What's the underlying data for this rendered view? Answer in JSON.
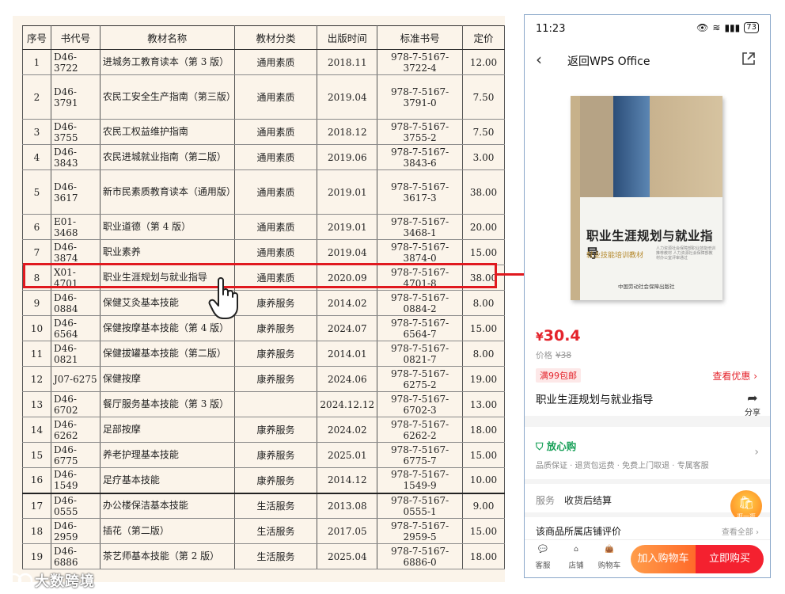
{
  "catalog": {
    "headers": [
      "序号",
      "书代号",
      "教材名称",
      "教材分类",
      "出版时间",
      "标准书号",
      "定价"
    ],
    "rows": [
      [
        "1",
        "D46-3722",
        "进城务工教育读本（第 3 版）",
        "通用素质",
        "2018.11",
        "978-7-5167-3722-4",
        "12.00"
      ],
      [
        "2",
        "D46-3791",
        "农民工安全生产指南（第三版）",
        "通用素质",
        "2019.04",
        "978-7-5167-3791-0",
        "7.50"
      ],
      [
        "3",
        "D46-3755",
        "农民工权益维护指南",
        "通用素质",
        "2018.12",
        "978-7-5167-3755-2",
        "7.50"
      ],
      [
        "4",
        "D46-3843",
        "农民进城就业指南（第二版）",
        "通用素质",
        "2019.06",
        "978-7-5167-3843-6",
        "3.00"
      ],
      [
        "5",
        "D46-3617",
        "新市民素质教育读本（通用版）",
        "通用素质",
        "2019.01",
        "978-7-5167-3617-3",
        "38.00"
      ],
      [
        "6",
        "E01-3468",
        "职业道德（第 4 版）",
        "通用素质",
        "2019.01",
        "978-7-5167-3468-1",
        "20.00"
      ],
      [
        "7",
        "D46-3874",
        "职业素养",
        "通用素质",
        "2019.04",
        "978-7-5167-3874-0",
        "15.00"
      ],
      [
        "8",
        "X01-4701",
        "职业生涯规划与就业指导",
        "通用素质",
        "2020.09",
        "978-7-5167-4701-8",
        "38.00"
      ],
      [
        "9",
        "D46-0884",
        "保健艾灸基本技能",
        "康养服务",
        "2014.02",
        "978-7-5167-0884-2",
        "8.00"
      ],
      [
        "10",
        "D46-6564",
        "保健按摩基本技能（第 4 版）",
        "康养服务",
        "2024.07",
        "978-7-5167-6564-7",
        "15.00"
      ],
      [
        "11",
        "D46-0821",
        "保健拔罐基本技能（第二版）",
        "康养服务",
        "2014.01",
        "978-7-5167-0821-7",
        "8.00"
      ],
      [
        "12",
        "J07-6275",
        "保健按摩",
        "康养服务",
        "2024.06",
        "978-7-5167-6275-2",
        "19.00"
      ],
      [
        "13",
        "D46-6702",
        "餐厅服务基本技能（第 3 版）",
        "",
        "2024.12.12",
        "978-7-5167-6702-3",
        "13.00"
      ],
      [
        "14",
        "D46-6262",
        "足部按摩",
        "康养服务",
        "2024.02",
        "978-7-5167-6262-2",
        "18.00"
      ],
      [
        "15",
        "D46-6775",
        "养老护理基本技能",
        "康养服务",
        "2025.01",
        "978-7-5167-6775-7",
        "15.00"
      ],
      [
        "16",
        "D46-1549",
        "足疗基本技能",
        "康养服务",
        "2014.12",
        "978-7-5167-1549-9",
        "10.00"
      ],
      [
        "17",
        "D46-0555",
        "办公楼保洁基本技能",
        "生活服务",
        "2013.08",
        "978-7-5167-0555-1",
        "9.00"
      ],
      [
        "18",
        "D46-2959",
        "插花（第二版）",
        "生活服务",
        "2017.05",
        "978-7-5167-2959-5",
        "15.00"
      ],
      [
        "19",
        "D46-6886",
        "茶艺师基本技能（第 2 版）",
        "生活服务",
        "2025.04",
        "978-7-5167-6886-0",
        "18.00"
      ]
    ],
    "highlight_row": 8
  },
  "watermark": "大数跨境",
  "phone": {
    "status": {
      "time": "11:23",
      "battery": "73"
    },
    "nav": {
      "title": "返回WPS Office"
    },
    "book_cover": {
      "title": "职业生涯规划与就业指导",
      "subtitle": "就业技能培训教材",
      "note": "人力资源社会保障部职业技能培训推荐教材 人力资源社会保障部教材办公室评审通过",
      "publisher": "中国劳动社会保障出版社"
    },
    "price": {
      "currency": "¥",
      "value": "30.4",
      "orig_label": "价格",
      "orig_value": "¥38"
    },
    "promo": "满99包邮",
    "coupon": "查看优惠",
    "product_title": "职业生涯规划与就业指导",
    "share_label": "分享",
    "assurance": {
      "title": "放心购",
      "items": "品质保证 · 退货包运费 · 免费上门取退 · 专属客服"
    },
    "service": {
      "label": "服务",
      "value": "收货后结算"
    },
    "fab_label": "逛一逛",
    "review": {
      "label": "该商品所属店铺评价",
      "link": "查看全部"
    },
    "bottom": {
      "kefu": "客服",
      "shop": "店铺",
      "cart_tab": "购物车",
      "add_cart": "加入购物车",
      "buy_now": "立即购买"
    },
    "colors": {
      "accent": "#e4232b",
      "green": "#18a058",
      "orange": "#ff7a2a"
    }
  }
}
